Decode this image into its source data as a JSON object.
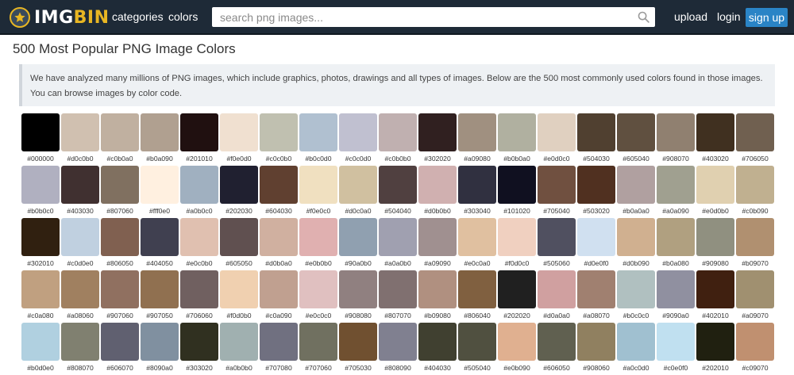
{
  "header": {
    "logo_text_primary": "IMG",
    "logo_text_accent": "BIN",
    "nav": {
      "categories": "categories",
      "colors": "colors"
    },
    "search": {
      "placeholder": "search png images..."
    },
    "upload": "upload",
    "login": "login",
    "signup": "sign up",
    "accent_color": "#e8b623",
    "signup_color": "#2a84c6"
  },
  "main": {
    "title": "500 Most Popular PNG Image Colors",
    "intro": "We have analyzed many millions of PNG images, which include graphics, photos, drawings and all types of images. Below are the 500 most commonly used colors found in those images. You can browse images by color code."
  },
  "colors": [
    [
      "#000000",
      "#d0c0b0",
      "#c0b0a0",
      "#b0a090",
      "#201010",
      "#f0e0d0",
      "#c0c0b0",
      "#b0c0d0",
      "#c0c0d0",
      "#c0b0b0",
      "#302020",
      "#a09080",
      "#b0b0a0",
      "#e0d0c0",
      "#504030",
      "#605040",
      "#908070",
      "#403020",
      "#706050"
    ],
    [
      "#b0b0c0",
      "#403030",
      "#807060",
      "#fff0e0",
      "#a0b0c0",
      "#202030",
      "#604030",
      "#f0e0c0",
      "#d0c0a0",
      "#504040",
      "#d0b0b0",
      "#303040",
      "#101020",
      "#705040",
      "#503020",
      "#b0a0a0",
      "#a0a090",
      "#e0d0b0",
      "#c0b090"
    ],
    [
      "#302010",
      "#c0d0e0",
      "#806050",
      "#404050",
      "#e0c0b0",
      "#605050",
      "#d0b0a0",
      "#e0b0b0",
      "#90a0b0",
      "#a0a0b0",
      "#a09090",
      "#e0c0a0",
      "#f0d0c0",
      "#505060",
      "#d0e0f0",
      "#d0b090",
      "#b0a080",
      "#909080",
      "#b09070"
    ],
    [
      "#c0a080",
      "#a08060",
      "#907060",
      "#907050",
      "#706060",
      "#f0d0b0",
      "#c0a090",
      "#e0c0c0",
      "#908080",
      "#807070",
      "#b09080",
      "#806040",
      "#202020",
      "#d0a0a0",
      "#a08070",
      "#b0c0c0",
      "#9090a0",
      "#402010",
      "#a09070"
    ],
    [
      "#b0d0e0",
      "#808070",
      "#606070",
      "#8090a0",
      "#303020",
      "#a0b0b0",
      "#707080",
      "#707060",
      "#705030",
      "#808090",
      "#404030",
      "#505040",
      "#e0b090",
      "#606050",
      "#908060",
      "#a0c0d0",
      "#c0e0f0",
      "#202010",
      "#c09070"
    ]
  ]
}
